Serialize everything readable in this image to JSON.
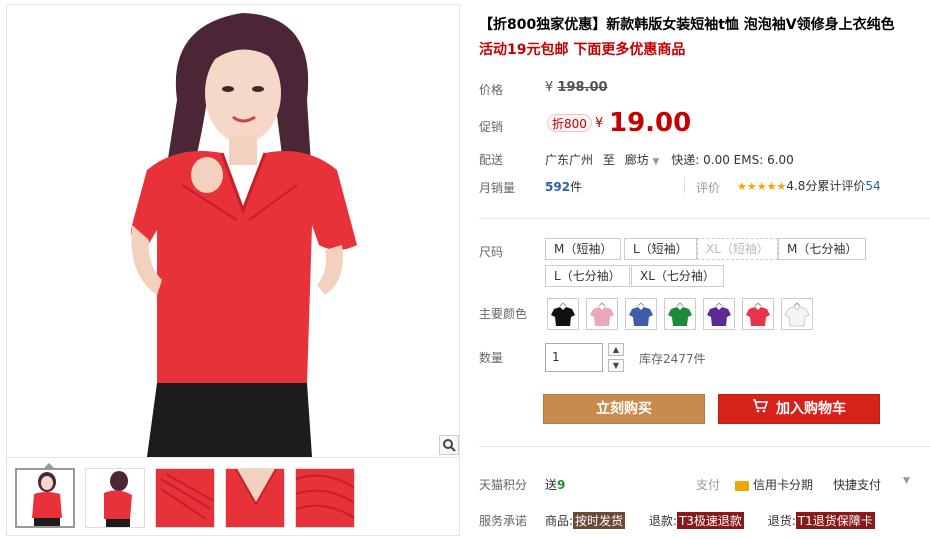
{
  "product": {
    "title": "【折800独家优惠】新款韩版女装短袖t恤 泡泡袖V领修身上衣纯色",
    "subtitle": "活动19元包邮 下面更多优惠商品"
  },
  "price": {
    "label": "价格",
    "currency": "¥",
    "value": "198.00"
  },
  "promo": {
    "label": "促销",
    "badge": "折800",
    "currency": "¥",
    "value": "19.00"
  },
  "shipping": {
    "label": "配送",
    "from": "广东广州",
    "to_word": "至",
    "to": "廊坊",
    "detail": "快递: 0.00 EMS: 6.00"
  },
  "sales": {
    "label": "月销量",
    "count": "592",
    "unit": "件",
    "review_label": "评价",
    "stars": "★★★★★",
    "rating": "4.8分",
    "review_count_label": "累计评价",
    "review_count": "54"
  },
  "size": {
    "label": "尺码",
    "options": [
      "M（短袖）",
      "L（短袖）",
      "XL（短袖）",
      "M（七分袖）",
      "L（七分袖）",
      "XL（七分袖）"
    ]
  },
  "color": {
    "label": "主要颜色",
    "swatches": [
      "#111111",
      "#e9a9b8",
      "#3d5ea8",
      "#1f8a3a",
      "#5b2a96",
      "#e8334a",
      "#f4f4f4"
    ]
  },
  "quantity": {
    "label": "数量",
    "value": "1",
    "stock": "库存2477件"
  },
  "actions": {
    "buy": "立刻购买",
    "cart": "加入购物车"
  },
  "points": {
    "label": "天猫积分",
    "send": "送",
    "value": "9",
    "pay_label": "支付",
    "credit": "信用卡分期",
    "quick": "快捷支付"
  },
  "service": {
    "label": "服务承诺",
    "goods_label": "商品:",
    "goods_tag": "按时发货",
    "refund_label": "退款:",
    "refund_tag": "T3极速退款",
    "return_label": "退货:",
    "return_tag": "T1退货保障卡"
  },
  "colors": {
    "accent": "#c40000",
    "shirt": "#e8323a",
    "buy_button": "#c98a4d",
    "cart_button": "#d7221b"
  }
}
